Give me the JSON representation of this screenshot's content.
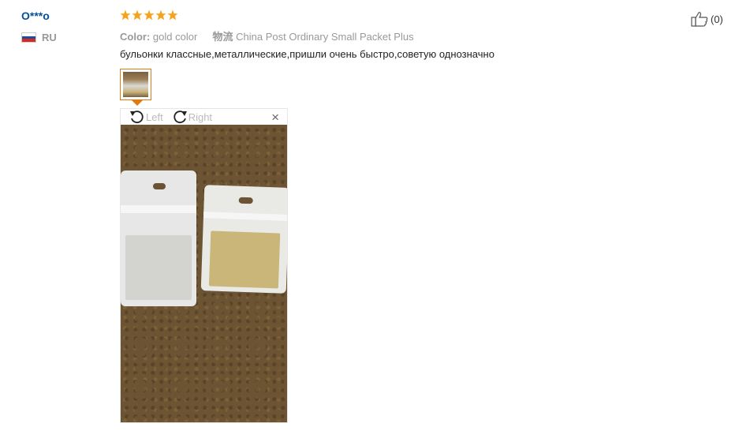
{
  "reviewer": {
    "name": "O***o",
    "country_code": "RU",
    "flag_colors": [
      "#ffffff",
      "#1b4ea3",
      "#d52b1e"
    ]
  },
  "rating": {
    "stars": 5,
    "max": 5,
    "color": "#f7a21b"
  },
  "meta": {
    "color_label": "Color:",
    "color_value": "gold color",
    "shipping_label": "物流",
    "shipping_value": "China Post Ordinary Small Packet Plus"
  },
  "review_text": "бульонки классные,металлические,пришли очень быстро,советую однозначно",
  "viewer": {
    "rotate_left_label": "Left",
    "rotate_right_label": "Right",
    "close_label": "×"
  },
  "helpful": {
    "count_label": "(0)"
  },
  "colors": {
    "accent_orange": "#e07b14",
    "username_blue": "#05509a"
  }
}
